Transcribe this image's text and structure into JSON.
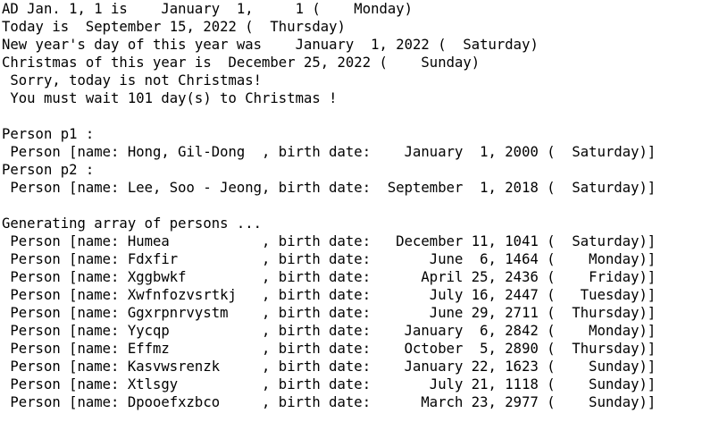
{
  "console": {
    "lines": [
      "AD Jan. 1, 1 is    January  1,     1 (    Monday)",
      "Today is  September 15, 2022 (  Thursday)",
      "New year's day of this year was    January  1, 2022 (  Saturday)",
      "Christmas of this year is  December 25, 2022 (    Sunday)",
      " Sorry, today is not Christmas!",
      " You must wait 101 day(s) to Christmas !",
      "",
      "Person p1 :",
      " Person [name: Hong, Gil-Dong  , birth date:    January  1, 2000 (  Saturday)]",
      "Person p2 :",
      " Person [name: Lee, Soo - Jeong, birth date:  September  1, 2018 (  Saturday)]",
      "",
      "Generating array of persons ...",
      " Person [name: Humea           , birth date:   December 11, 1041 (  Saturday)]",
      " Person [name: Fdxfir          , birth date:       June  6, 1464 (    Monday)]",
      " Person [name: Xggbwkf         , birth date:      April 25, 2436 (    Friday)]",
      " Person [name: Xwfnfozvsrtkj   , birth date:       July 16, 2447 (   Tuesday)]",
      " Person [name: Ggxrpnrvystm    , birth date:       June 29, 2711 (  Thursday)]",
      " Person [name: Yycqp           , birth date:    January  6, 2842 (    Monday)]",
      " Person [name: Effmz           , birth date:    October  5, 2890 (  Thursday)]",
      " Person [name: Kasvwsrenzk     , birth date:    January 22, 1623 (    Sunday)]",
      " Person [name: Xtlsgy          , birth date:       July 21, 1118 (    Sunday)]",
      " Person [name: Dpooefxzbco     , birth date:      March 23, 2977 (    Sunday)]"
    ]
  }
}
